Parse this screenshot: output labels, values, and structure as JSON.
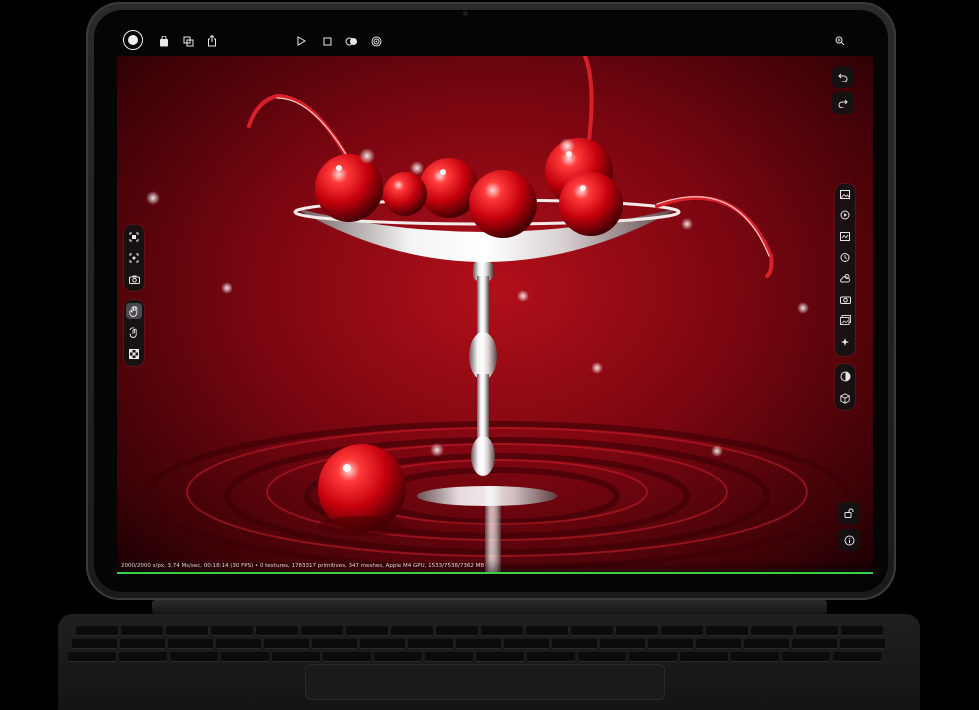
{
  "toolbar_top": {
    "left_icons": [
      "record-icon",
      "bag-icon",
      "export-icon",
      "share-icon"
    ],
    "center_icons": [
      "play-icon",
      "stop-icon",
      "toggle-view-icon",
      "target-icon"
    ],
    "right_icons": [
      "zoom-icon"
    ]
  },
  "history": {
    "icons": [
      "undo-icon",
      "redo-icon"
    ]
  },
  "left_tools": {
    "group1": [
      "frame-select-icon",
      "focus-icon",
      "camera-icon"
    ],
    "group2": [
      "hand-icon",
      "rotate-hand-icon",
      "checker-icon"
    ]
  },
  "right_tools": {
    "group1": [
      "image-icon",
      "render-icon",
      "texture-icon",
      "timer-icon",
      "weather-icon",
      "camera-settings-icon",
      "gallery-icon",
      "sparkle-icon"
    ],
    "group2": [
      "shading-icon",
      "cube-icon"
    ],
    "bottom": [
      "lock-icon",
      "info-icon"
    ]
  },
  "status": {
    "text": "2000/2000 s/px, 3.74 Ms/sec, 00:18:14 (30 FPS) • 0 textures, 1783317 primitives, 347 meshes, Apple M4 GPU, 1533/7538/7362 MB",
    "progress": 1.0
  },
  "colors": {
    "viewport_center": "#b2101a",
    "viewport_edge": "#1a0003",
    "progress": "#38d24a",
    "toolbar_bg": "#121214"
  }
}
